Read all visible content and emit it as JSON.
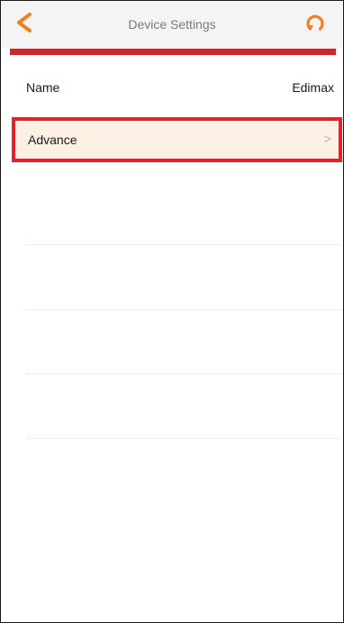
{
  "header": {
    "title": "Device Settings"
  },
  "settings": {
    "name_label": "Name",
    "name_value": "Edimax",
    "advance_label": "Advance",
    "advance_chevron": ">"
  },
  "colors": {
    "accent_orange": "#f07f22",
    "accent_red": "#c42a30",
    "highlight_border": "#e2232b",
    "highlight_fill": "#fcefe4"
  },
  "icons": {
    "back": "back-arrow-icon",
    "refresh": "refresh-icon",
    "chevron": "chevron-right-icon"
  }
}
